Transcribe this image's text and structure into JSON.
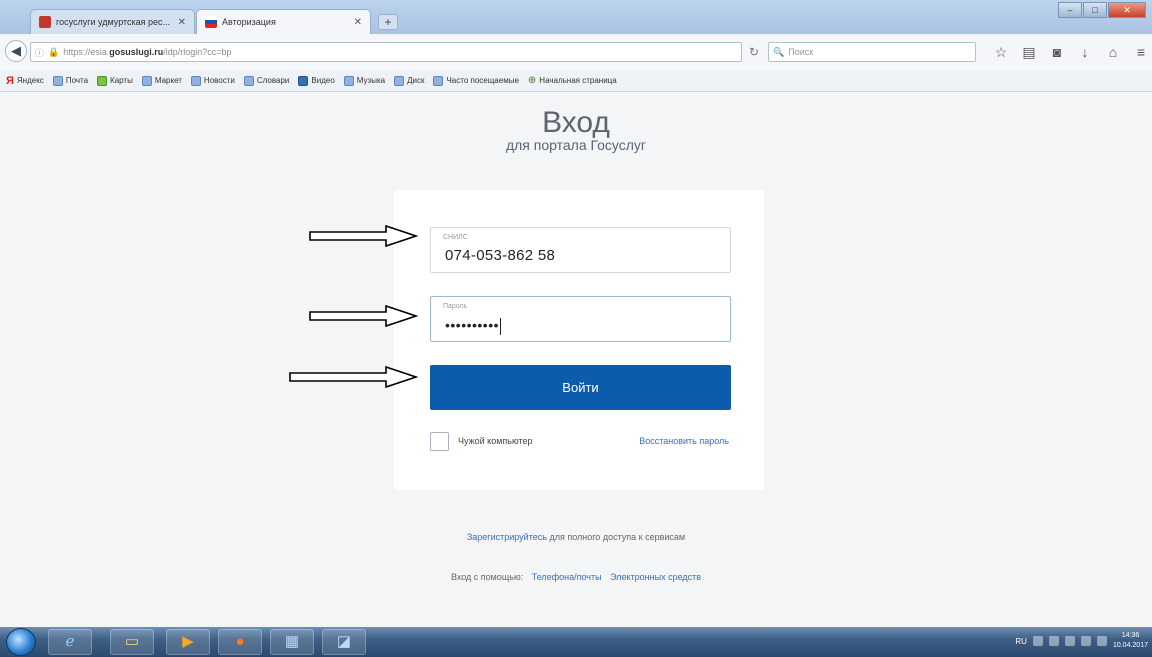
{
  "browser": {
    "tabs": [
      {
        "label": "госуслуги удмуртская рес...",
        "active": false,
        "favicon_color": "#c0392b"
      },
      {
        "label": "Авторизация",
        "active": true,
        "favicon_color": "#c0392b"
      }
    ],
    "url_prefix": "https://esia.",
    "url_domain": "gosuslugi.ru",
    "url_suffix": "/idp/rlogin?cc=bp",
    "search_placeholder": "Поиск",
    "bookmarks": [
      {
        "label": "Яндекс",
        "icon": "yandex-icon"
      },
      {
        "label": "Почта",
        "icon": "folder-icon"
      },
      {
        "label": "Карты",
        "icon": "green-icon"
      },
      {
        "label": "Маркет",
        "icon": "folder-icon"
      },
      {
        "label": "Новости",
        "icon": "folder-icon"
      },
      {
        "label": "Словари",
        "icon": "folder-icon"
      },
      {
        "label": "Видео",
        "icon": "blue-icon"
      },
      {
        "label": "Музыка",
        "icon": "folder-icon"
      },
      {
        "label": "Диск",
        "icon": "folder-icon"
      },
      {
        "label": "Часто посещаемые",
        "icon": "folder-icon"
      },
      {
        "label": "Начальная страница",
        "icon": "history-icon"
      }
    ]
  },
  "login": {
    "title": "Вход",
    "subtitle": "для портала Госуслуг",
    "snils_label": "СНИЛС",
    "snils_value": "074-053-862 58",
    "password_label": "Пароль",
    "password_value": "••••••••••",
    "submit_label": "Войти",
    "alien_computer_label": "Чужой компьютер",
    "restore_password_label": "Восстановить пароль",
    "register_link": "Зарегистрируйтесь",
    "register_text": " для полного доступа к сервисам",
    "login_with_label": "Вход с помощью:",
    "login_with_phone": "Телефона/почты",
    "login_with_digital": "Электронных средств"
  },
  "taskbar": {
    "language": "RU",
    "time": "14:36",
    "date": "10.04.2017"
  },
  "colors": {
    "primary_button": "#0d5bad",
    "link": "#3b6fb0",
    "page_background": "#f4f5f7"
  }
}
